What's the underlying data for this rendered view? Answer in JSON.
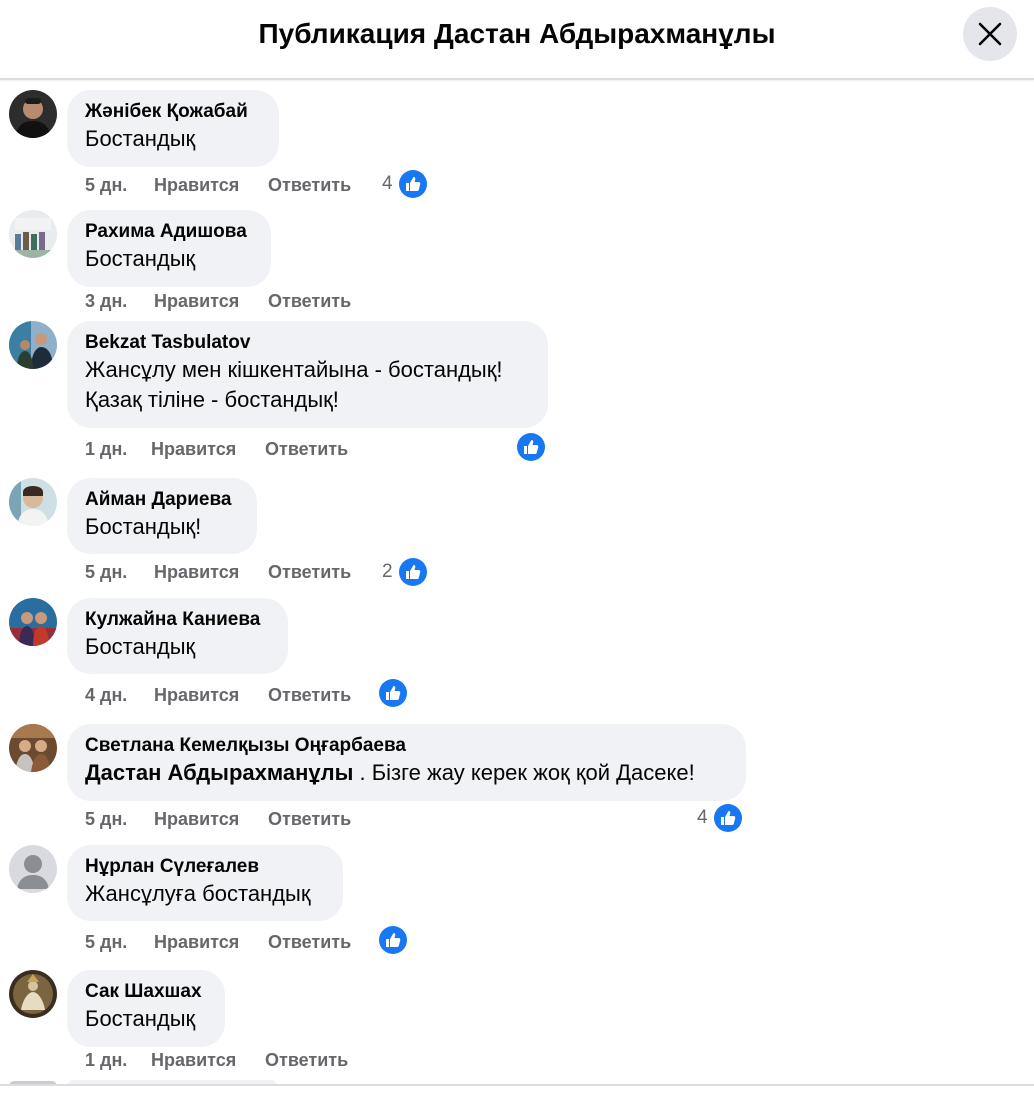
{
  "header": {
    "title": "Публикация Дастан Абдырахманұлы"
  },
  "actions": {
    "like_label": "Нравится",
    "reply_label": "Ответить"
  },
  "colors": {
    "like_blue": "#1877f2",
    "bubble_bg": "#f0f2f5",
    "meta_gray": "#65676b"
  },
  "comments": [
    {
      "author": "Жәнібек Қожабай",
      "text": "Бостандық",
      "time": "5 дн.",
      "reactions": "4",
      "avatar": "avatar-photo"
    },
    {
      "author": "Рахима Адишова",
      "text": "Бостандық",
      "time": "3 дн.",
      "reactions": "",
      "avatar": "avatar-photo"
    },
    {
      "author": "Bekzat Tasbulatov",
      "text_lines": [
        "Жансұлу мен кішкентайына - бостандық!",
        "Қазақ тіліне - бостандық!"
      ],
      "time": "1 дн.",
      "reactions": "",
      "avatar": "avatar-photo"
    },
    {
      "author": "Айман Дариева",
      "text": "Бостандық!",
      "time": "5 дн.",
      "reactions": "2",
      "avatar": "avatar-photo"
    },
    {
      "author": "Кулжайна Каниева",
      "text": "Бостандық",
      "time": "4 дн.",
      "reactions": "",
      "avatar": "avatar-photo"
    },
    {
      "author": "Светлана Кемелқызы Оңғарбаева",
      "mention": "Дастан Абдырахманұлы",
      "text": " . Бізге жау керек жоқ қой Дасеке!",
      "time": "5 дн.",
      "reactions": "4",
      "avatar": "avatar-photo"
    },
    {
      "author": "Нұрлан Сүлеғалев",
      "text": "Жансұлуға бостандық",
      "time": "5 дн.",
      "reactions": "",
      "avatar": "default-avatar-icon"
    },
    {
      "author": "Сак Шахшах",
      "text": "Бостандық",
      "time": "1 дн.",
      "reactions": "",
      "avatar": "avatar-photo"
    }
  ]
}
